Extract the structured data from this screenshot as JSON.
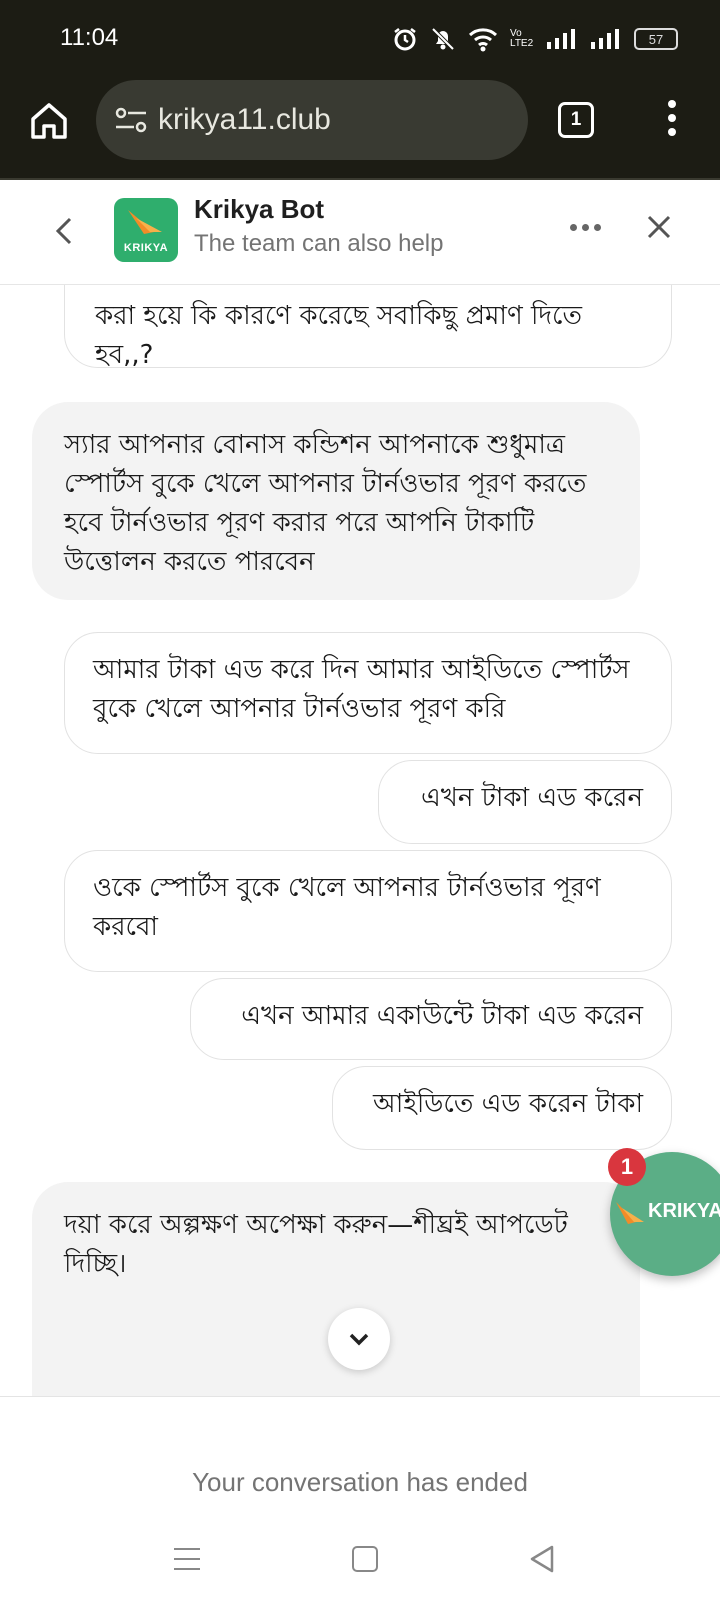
{
  "status_bar": {
    "time": "11:04",
    "battery": "57",
    "network": "Vo LTE2"
  },
  "browser": {
    "url": "krikya11.club",
    "tab_count": "1"
  },
  "chat_header": {
    "bot_name": "Krikya Bot",
    "subtitle": "The team can also help",
    "logo_text": "KRIKYA"
  },
  "messages": [
    {
      "sender": "user",
      "text": "করা হয়ে কি কারণে করেছে সবাকিছু প্রমাণ দিতে হব,,?"
    },
    {
      "sender": "bot",
      "text": "স্যার আপনার বোনাস কন্ডিশন আপনাকে শুধুমাত্র স্পোর্টস বুকে খেলে আপনার টার্নওভার পূরণ করতে হবে টার্নওভার পূরণ করার পরে আপনি টাকাটি উত্তোলন করতে পারবেন"
    },
    {
      "sender": "user",
      "text": "আমার টাকা এড করে দিন আমার আইডিতে স্পোর্টস বুকে খেলে আপনার টার্নওভার পূরণ করি"
    },
    {
      "sender": "user",
      "text": "এখন টাকা এড করেন"
    },
    {
      "sender": "user",
      "text": "ওকে স্পোর্টস বুকে খেলে আপনার টার্নওভার পূরণ করবো"
    },
    {
      "sender": "user",
      "text": "এখন আমার একাউন্টে টাকা এড করেন"
    },
    {
      "sender": "user",
      "text": "আইডিতে এড করেন টাকা"
    },
    {
      "sender": "bot",
      "text": "দয়া করে অল্পক্ষণ অপেক্ষা করুন—শীঘ্রই আপডেট দিচ্ছি।"
    }
  ],
  "fab": {
    "badge": "1",
    "logo_text": "KRIKYA"
  },
  "footer": {
    "ended_text": "Your conversation has ended"
  },
  "colors": {
    "brand_green": "#2fae6d",
    "fab_green": "#5bae86",
    "badge_red": "#d9363e",
    "browser_bg": "#1c1c14"
  }
}
